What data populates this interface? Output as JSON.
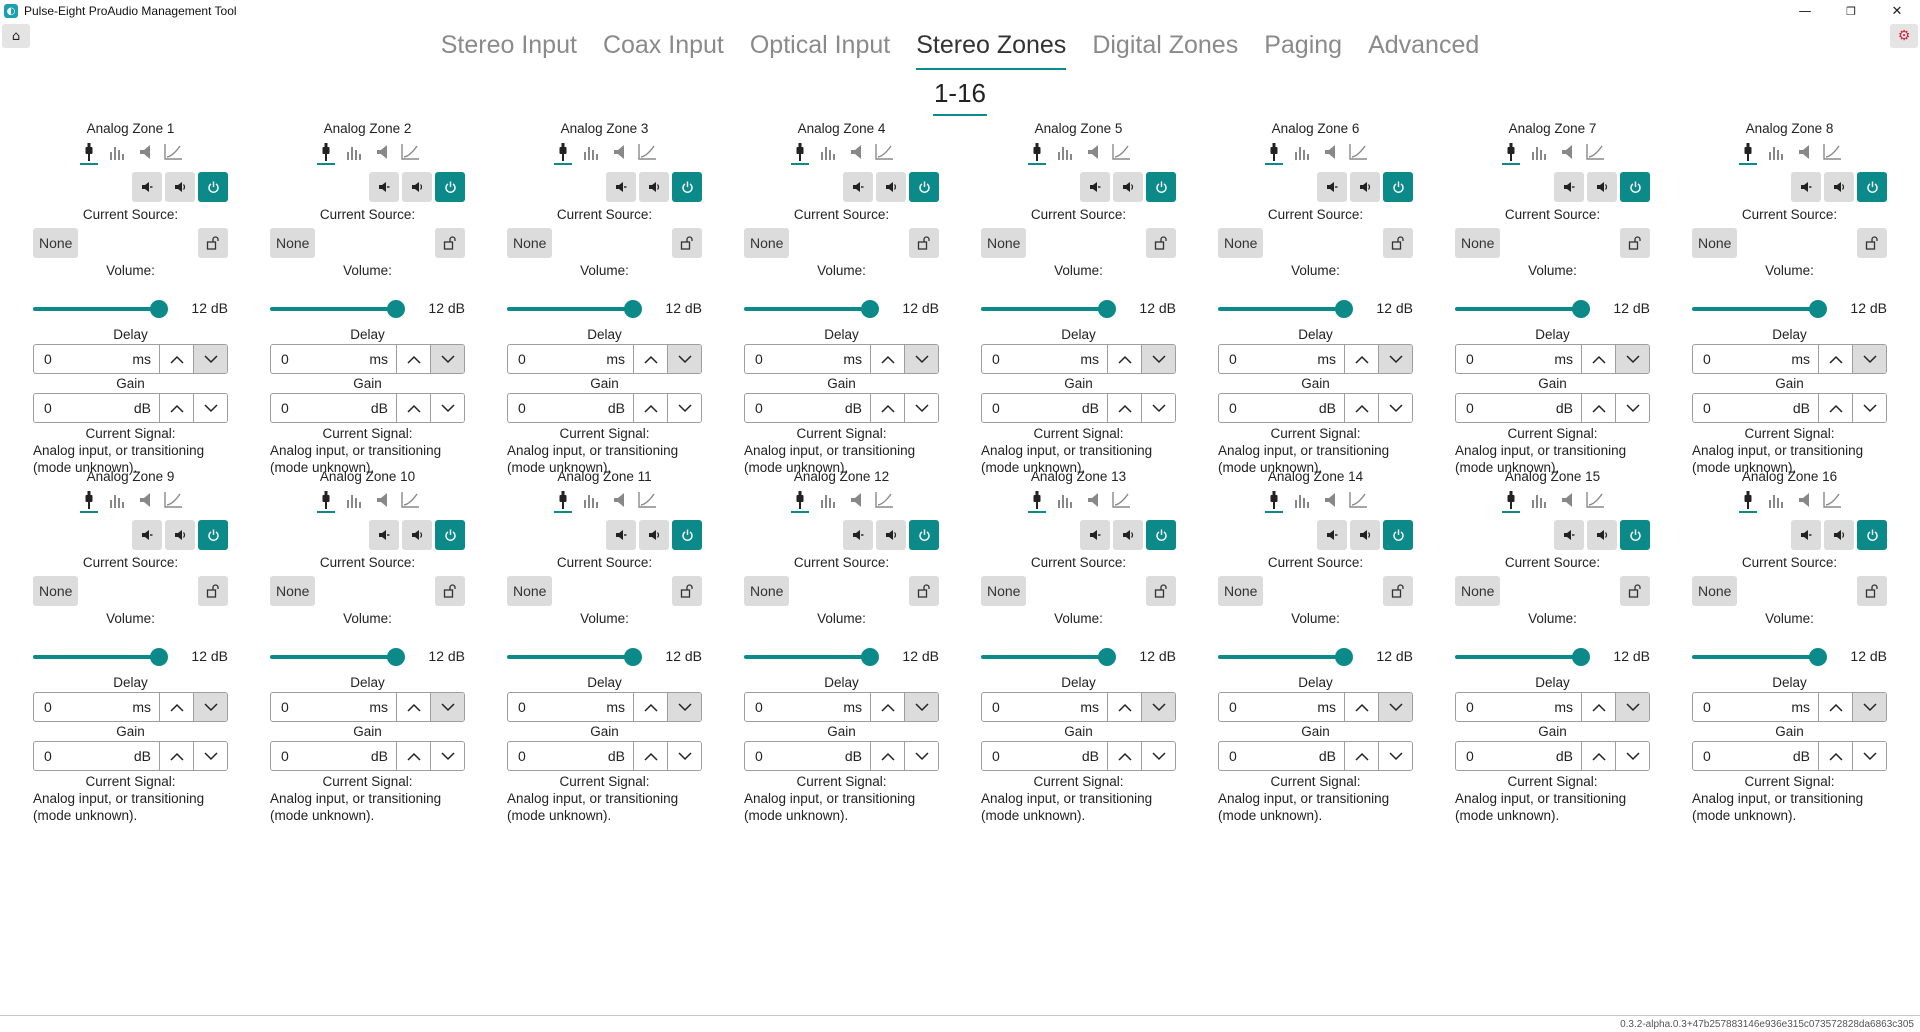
{
  "window": {
    "title": "Pulse-Eight ProAudio Management Tool",
    "minimize": "—",
    "maximize": "❐",
    "close": "✕"
  },
  "toolbar": {
    "home_icon": "home-icon",
    "settings_icon": "gear-icon",
    "home_glyph": "⌂",
    "settings_glyph": "⚙"
  },
  "tabs": [
    {
      "label": "Stereo Input",
      "active": false
    },
    {
      "label": "Coax Input",
      "active": false
    },
    {
      "label": "Optical Input",
      "active": false
    },
    {
      "label": "Stereo Zones",
      "active": true
    },
    {
      "label": "Digital Zones",
      "active": false
    },
    {
      "label": "Paging",
      "active": false
    },
    {
      "label": "Advanced",
      "active": false
    }
  ],
  "subtab": "1-16",
  "labels": {
    "current_source": "Current Source:",
    "volume": "Volume:",
    "delay": "Delay",
    "gain": "Gain",
    "current_signal": "Current Signal:",
    "ms": "ms",
    "db": "dB"
  },
  "colors": {
    "accent": "#0c8a8a",
    "button_bg": "#dcdcdc"
  },
  "zones": [
    {
      "name": "Analog Zone 1",
      "source": "None",
      "volume": "12 dB",
      "volume_level": 1.0,
      "delay": "0",
      "gain": "0",
      "signal_line1": "Analog input, or transitioning",
      "signal_line2": "(mode unknown)."
    },
    {
      "name": "Analog Zone 2",
      "source": "None",
      "volume": "12 dB",
      "volume_level": 1.0,
      "delay": "0",
      "gain": "0",
      "signal_line1": "Analog input, or transitioning",
      "signal_line2": "(mode unknown)."
    },
    {
      "name": "Analog Zone 3",
      "source": "None",
      "volume": "12 dB",
      "volume_level": 1.0,
      "delay": "0",
      "gain": "0",
      "signal_line1": "Analog input, or transitioning",
      "signal_line2": "(mode unknown)."
    },
    {
      "name": "Analog Zone 4",
      "source": "None",
      "volume": "12 dB",
      "volume_level": 1.0,
      "delay": "0",
      "gain": "0",
      "signal_line1": "Analog input, or transitioning",
      "signal_line2": "(mode unknown)."
    },
    {
      "name": "Analog Zone 5",
      "source": "None",
      "volume": "12 dB",
      "volume_level": 1.0,
      "delay": "0",
      "gain": "0",
      "signal_line1": "Analog input, or transitioning",
      "signal_line2": "(mode unknown)."
    },
    {
      "name": "Analog Zone 6",
      "source": "None",
      "volume": "12 dB",
      "volume_level": 1.0,
      "delay": "0",
      "gain": "0",
      "signal_line1": "Analog input, or transitioning",
      "signal_line2": "(mode unknown)."
    },
    {
      "name": "Analog Zone 7",
      "source": "None",
      "volume": "12 dB",
      "volume_level": 1.0,
      "delay": "0",
      "gain": "0",
      "signal_line1": "Analog input, or transitioning",
      "signal_line2": "(mode unknown)."
    },
    {
      "name": "Analog Zone 8",
      "source": "None",
      "volume": "12 dB",
      "volume_level": 1.0,
      "delay": "0",
      "gain": "0",
      "signal_line1": "Analog input, or transitioning",
      "signal_line2": "(mode unknown)."
    },
    {
      "name": "Analog Zone 9",
      "source": "None",
      "volume": "12 dB",
      "volume_level": 1.0,
      "delay": "0",
      "gain": "0",
      "signal_line1": "Analog input, or transitioning",
      "signal_line2": "(mode unknown)."
    },
    {
      "name": "Analog Zone 10",
      "source": "None",
      "volume": "12 dB",
      "volume_level": 1.0,
      "delay": "0",
      "gain": "0",
      "signal_line1": "Analog input, or transitioning",
      "signal_line2": "(mode unknown)."
    },
    {
      "name": "Analog Zone 11",
      "source": "None",
      "volume": "12 dB",
      "volume_level": 1.0,
      "delay": "0",
      "gain": "0",
      "signal_line1": "Analog input, or transitioning",
      "signal_line2": "(mode unknown)."
    },
    {
      "name": "Analog Zone 12",
      "source": "None",
      "volume": "12 dB",
      "volume_level": 1.0,
      "delay": "0",
      "gain": "0",
      "signal_line1": "Analog input, or transitioning",
      "signal_line2": "(mode unknown)."
    },
    {
      "name": "Analog Zone 13",
      "source": "None",
      "volume": "12 dB",
      "volume_level": 1.0,
      "delay": "0",
      "gain": "0",
      "signal_line1": "Analog input, or transitioning",
      "signal_line2": "(mode unknown)."
    },
    {
      "name": "Analog Zone 14",
      "source": "None",
      "volume": "12 dB",
      "volume_level": 1.0,
      "delay": "0",
      "gain": "0",
      "signal_line1": "Analog input, or transitioning",
      "signal_line2": "(mode unknown)."
    },
    {
      "name": "Analog Zone 15",
      "source": "None",
      "volume": "12 dB",
      "volume_level": 1.0,
      "delay": "0",
      "gain": "0",
      "signal_line1": "Analog input, or transitioning",
      "signal_line2": "(mode unknown)."
    },
    {
      "name": "Analog Zone 16",
      "source": "None",
      "volume": "12 dB",
      "volume_level": 1.0,
      "delay": "0",
      "gain": "0",
      "signal_line1": "Analog input, or transitioning",
      "signal_line2": "(mode unknown)."
    }
  ],
  "version": "0.3.2-alpha.0.3+47b257883146e936e315c073572828da6863c305"
}
